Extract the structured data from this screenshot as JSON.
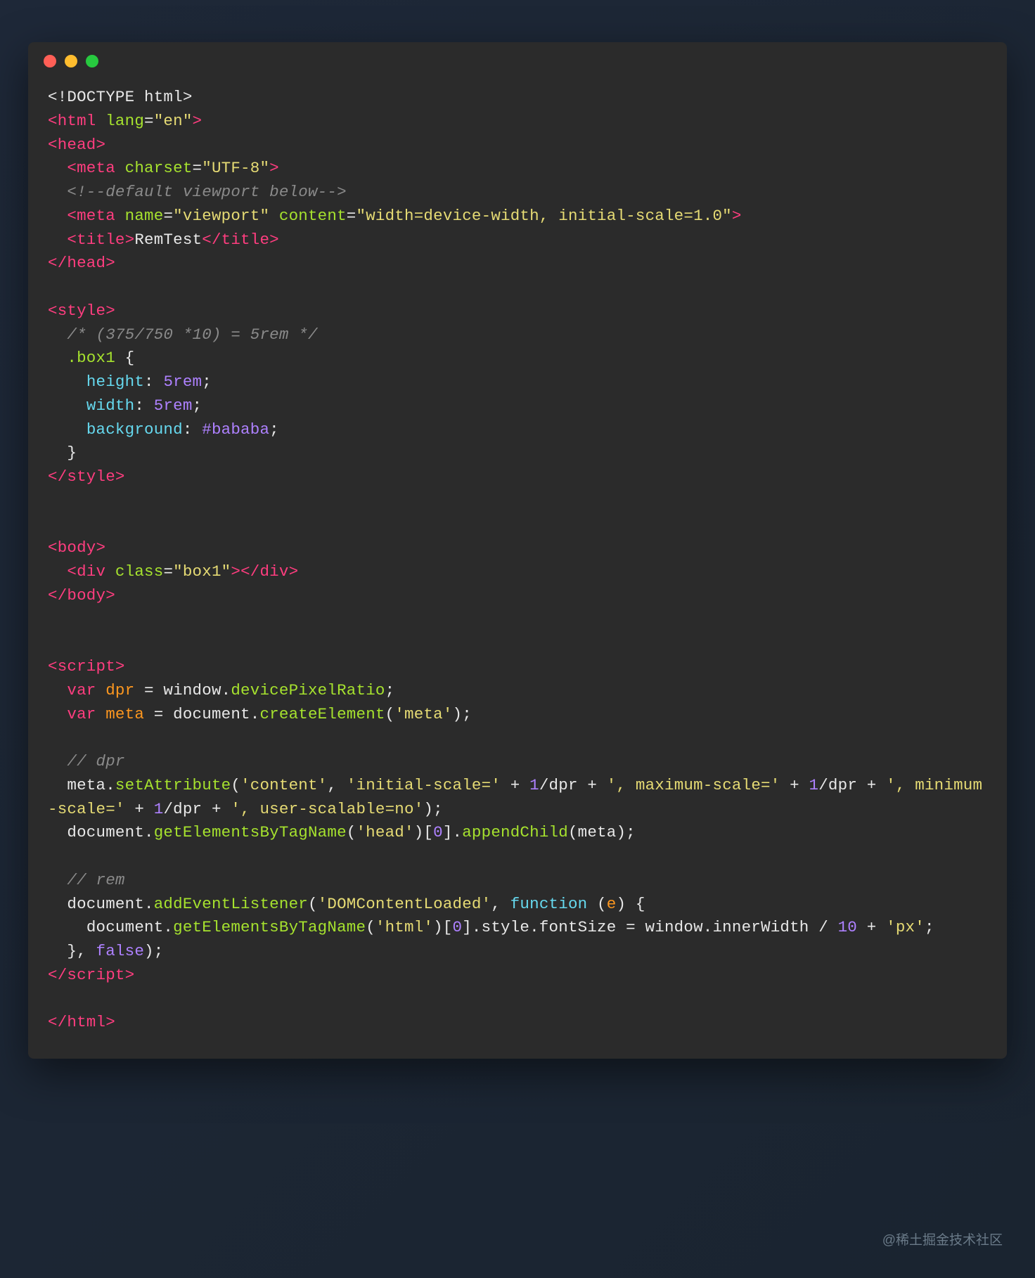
{
  "window": {
    "traffic_lights": [
      "close",
      "minimize",
      "zoom"
    ]
  },
  "code": {
    "l01": {
      "a": "<!DOCTYPE html>"
    },
    "l02": {
      "a": "<",
      "b": "html",
      "c": " lang",
      "d": "=",
      "e": "\"en\"",
      "f": ">"
    },
    "l03": {
      "a": "<",
      "b": "head",
      "c": ">"
    },
    "l04": {
      "pad": "  ",
      "a": "<",
      "b": "meta",
      "c": " charset",
      "d": "=",
      "e": "\"UTF-8\"",
      "f": ">"
    },
    "l05": {
      "pad": "  ",
      "a": "<!--default viewport below-->"
    },
    "l06": {
      "pad": "  ",
      "a": "<",
      "b": "meta",
      "c": " name",
      "d": "=",
      "e": "\"viewport\"",
      "f": " content",
      "g": "=",
      "h": "\"width=device-width, initial-scale=1.0\"",
      "i": ">"
    },
    "l07": {
      "pad": "  ",
      "a": "<",
      "b": "title",
      "c": ">",
      "d": "RemTest",
      "e": "</",
      "f": "title",
      "g": ">"
    },
    "l08": {
      "a": "</",
      "b": "head",
      "c": ">"
    },
    "l10": {
      "a": "<",
      "b": "style",
      "c": ">"
    },
    "l11": {
      "pad": "  ",
      "a": "/* (375/750 *10) = 5rem */"
    },
    "l12": {
      "pad": "  ",
      "a": ".box1",
      "b": " {"
    },
    "l13": {
      "pad": "    ",
      "a": "height",
      "b": ": ",
      "c": "5rem",
      "d": ";"
    },
    "l14": {
      "pad": "    ",
      "a": "width",
      "b": ": ",
      "c": "5rem",
      "d": ";"
    },
    "l15": {
      "pad": "    ",
      "a": "background",
      "b": ": ",
      "c": "#bababa",
      "d": ";"
    },
    "l16": {
      "pad": "  ",
      "a": "}"
    },
    "l17": {
      "a": "</",
      "b": "style",
      "c": ">"
    },
    "l19": {
      "a": "<",
      "b": "body",
      "c": ">"
    },
    "l20": {
      "pad": "  ",
      "a": "<",
      "b": "div",
      "c": " class",
      "d": "=",
      "e": "\"box1\"",
      "f": ">",
      "g": "</",
      "h": "div",
      "i": ">"
    },
    "l21": {
      "a": "</",
      "b": "body",
      "c": ">"
    },
    "l23": {
      "a": "<",
      "b": "script",
      "c": ">"
    },
    "l24": {
      "pad": "  ",
      "a": "var",
      "b": " dpr",
      "c": " = window.",
      "d": "devicePixelRatio",
      "e": ";"
    },
    "l25": {
      "pad": "  ",
      "a": "var",
      "b": " meta",
      "c": " = document.",
      "d": "createElement",
      "e": "(",
      "f": "'meta'",
      "g": ");"
    },
    "l27": {
      "pad": "  ",
      "a": "// dpr"
    },
    "l28": {
      "pad": "  ",
      "a": "meta.",
      "b": "setAttribute",
      "c": "(",
      "d": "'content'",
      "e": ", ",
      "f": "'initial-scale='",
      "g": " + ",
      "h": "1",
      "i": "/dpr + ",
      "j": "', maximum-scale='",
      "k": " + ",
      "l": "1",
      "m": "/dpr + ",
      "n": "', minimum-scale='",
      "o": " + ",
      "p": "1",
      "q": "/dpr + ",
      "r": "', user-scalable=no'",
      "s": ");"
    },
    "l29": {
      "pad": "  ",
      "a": "document.",
      "b": "getElementsByTagName",
      "c": "(",
      "d": "'head'",
      "e": ")[",
      "f": "0",
      "g": "].",
      "h": "appendChild",
      "i": "(meta);"
    },
    "l31": {
      "pad": "  ",
      "a": "// rem"
    },
    "l32": {
      "pad": "  ",
      "a": "document.",
      "b": "addEventListener",
      "c": "(",
      "d": "'DOMContentLoaded'",
      "e": ", ",
      "f": "function",
      "g": " (",
      "h": "e",
      "i": ") {"
    },
    "l33": {
      "pad": "    ",
      "a": "document.",
      "b": "getElementsByTagName",
      "c": "(",
      "d": "'html'",
      "e": ")[",
      "f": "0",
      "g": "].style.fontSize = window.innerWidth / ",
      "h": "10",
      "i": " + ",
      "j": "'px'",
      "k": ";"
    },
    "l34": {
      "pad": "  ",
      "a": "}, ",
      "b": "false",
      "c": ");"
    },
    "l35": {
      "a": "</",
      "b": "script",
      "c": ">"
    },
    "l37": {
      "a": "</",
      "b": "html",
      "c": ">"
    }
  },
  "watermark": "@稀土掘金技术社区"
}
